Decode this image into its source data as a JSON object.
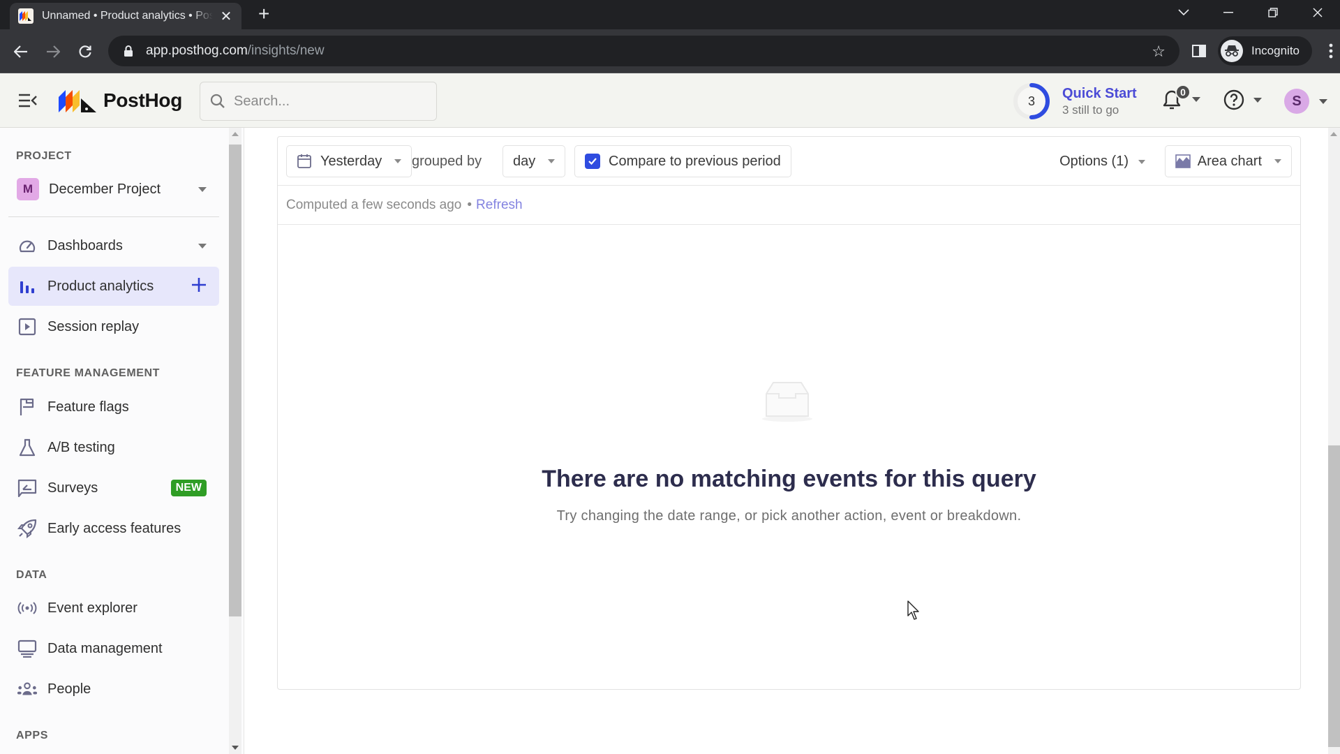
{
  "browser": {
    "tab_title": "Unnamed • Product analytics • PostHog",
    "new_tab_label": "+",
    "url_host": "app.posthog.com",
    "url_path": "/insights/new",
    "profile_label": "Incognito",
    "icons": {
      "back": "arrow-left-icon",
      "forward": "arrow-right-icon",
      "reload": "reload-icon",
      "lock": "lock-icon",
      "bookmark": "star-icon",
      "side_panel": "side-panel-icon",
      "menu": "kebab-menu-icon"
    }
  },
  "header": {
    "brand": "PostHog",
    "search_placeholder": "Search...",
    "quick_start": {
      "title": "Quick Start",
      "remaining_count": "3",
      "subtitle": "3 still to go",
      "progress_fraction": 0.5,
      "ring_color": "#2f4ce0"
    },
    "notifications_count": "0",
    "user_initial": "S"
  },
  "sidebar": {
    "project_section": "PROJECT",
    "project": {
      "initial": "M",
      "name": "December Project"
    },
    "items_primary": [
      {
        "label": "Dashboards",
        "icon": "gauge-icon",
        "has_dropdown": true
      },
      {
        "label": "Product analytics",
        "icon": "bar-chart-icon",
        "active": true,
        "has_add": true
      },
      {
        "label": "Session replay",
        "icon": "play-square-icon"
      }
    ],
    "feature_section": "FEATURE MANAGEMENT",
    "items_feature": [
      {
        "label": "Feature flags",
        "icon": "flag-icon"
      },
      {
        "label": "A/B testing",
        "icon": "flask-icon"
      },
      {
        "label": "Surveys",
        "icon": "survey-icon",
        "badge": "NEW"
      },
      {
        "label": "Early access features",
        "icon": "rocket-icon"
      }
    ],
    "data_section": "DATA",
    "items_data": [
      {
        "label": "Event explorer",
        "icon": "broadcast-icon"
      },
      {
        "label": "Data management",
        "icon": "database-monitor-icon"
      },
      {
        "label": "People",
        "icon": "people-icon"
      }
    ],
    "apps_section": "APPS"
  },
  "insight": {
    "date_range": "Yesterday",
    "grouped_by_label": "grouped by",
    "interval": "day",
    "compare_label": "Compare to previous period",
    "compare_checked": true,
    "options_label": "Options (1)",
    "chart_type": "Area chart",
    "computed_text": "Computed a few seconds ago",
    "separator": "•",
    "refresh_label": "Refresh",
    "empty_title": "There are no matching events for this query",
    "empty_description": "Try changing the date range, or pick another action, event or breakdown."
  },
  "colors": {
    "accent": "#2f4ce0",
    "link": "#8383e0",
    "new_badge": "#2f9d25",
    "active_nav_bg": "#e7e7fb"
  }
}
